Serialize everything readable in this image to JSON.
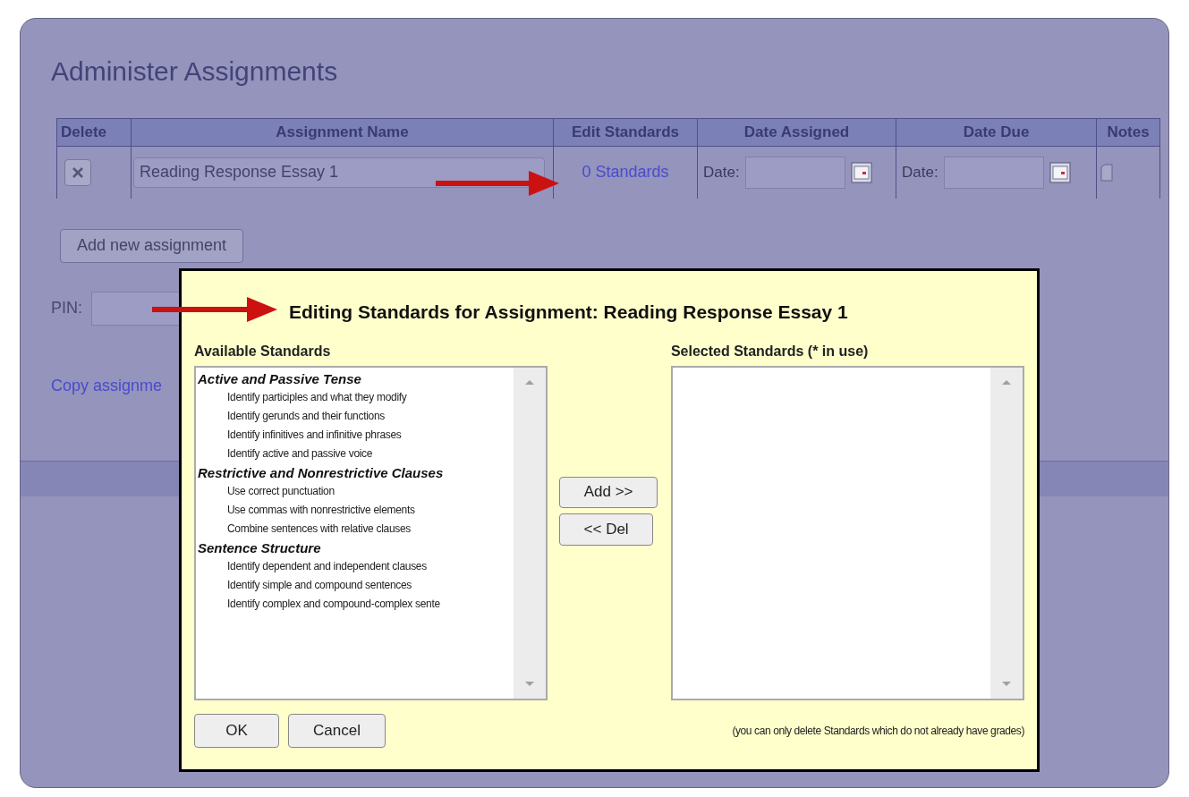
{
  "page": {
    "title": "Administer Assignments"
  },
  "table": {
    "columns": [
      "Delete",
      "Assignment Name",
      "Edit Standards",
      "Date Assigned",
      "Date Due",
      "Notes"
    ],
    "rows": [
      {
        "name": "Reading Response Essay 1",
        "standards_link": "0 Standards",
        "date_assigned_label": "Date:",
        "date_due_label": "Date:"
      }
    ]
  },
  "add_button": "Add new assignment",
  "pin_label": "PIN:",
  "copy_link": "Copy assignme",
  "dialog": {
    "title": "Editing Standards for Assignment: Reading Response Essay 1",
    "available_label": "Available Standards",
    "available": [
      {
        "label": "Active and Passive Tense",
        "children": [
          {
            "label": "Identify participles and what they modify"
          },
          {
            "label": "Identify gerunds and their functions"
          },
          {
            "label": "Identify infinitives and infinitive phrases"
          },
          {
            "label": "Identify active and passive voice"
          }
        ]
      },
      {
        "label": "Restrictive and Nonrestrictive Clauses",
        "children": [
          {
            "label": "Use correct punctuation"
          },
          {
            "label": "Use commas with nonrestrictive elements"
          },
          {
            "label": "Combine sentences with relative clauses"
          }
        ]
      },
      {
        "label": "Sentence Structure",
        "children": [
          {
            "label": "Identify dependent and independent clauses"
          },
          {
            "label": "Identify simple and compound sentences"
          },
          {
            "label": "Identify complex and compound-complex sente"
          }
        ]
      }
    ],
    "selected_label": "Selected Standards (* in use)",
    "add_button": "Add >>",
    "del_button": "<< Del",
    "ok_button": "OK",
    "cancel_button": "Cancel",
    "note": "(you can only delete Standards which do not already have grades)"
  }
}
